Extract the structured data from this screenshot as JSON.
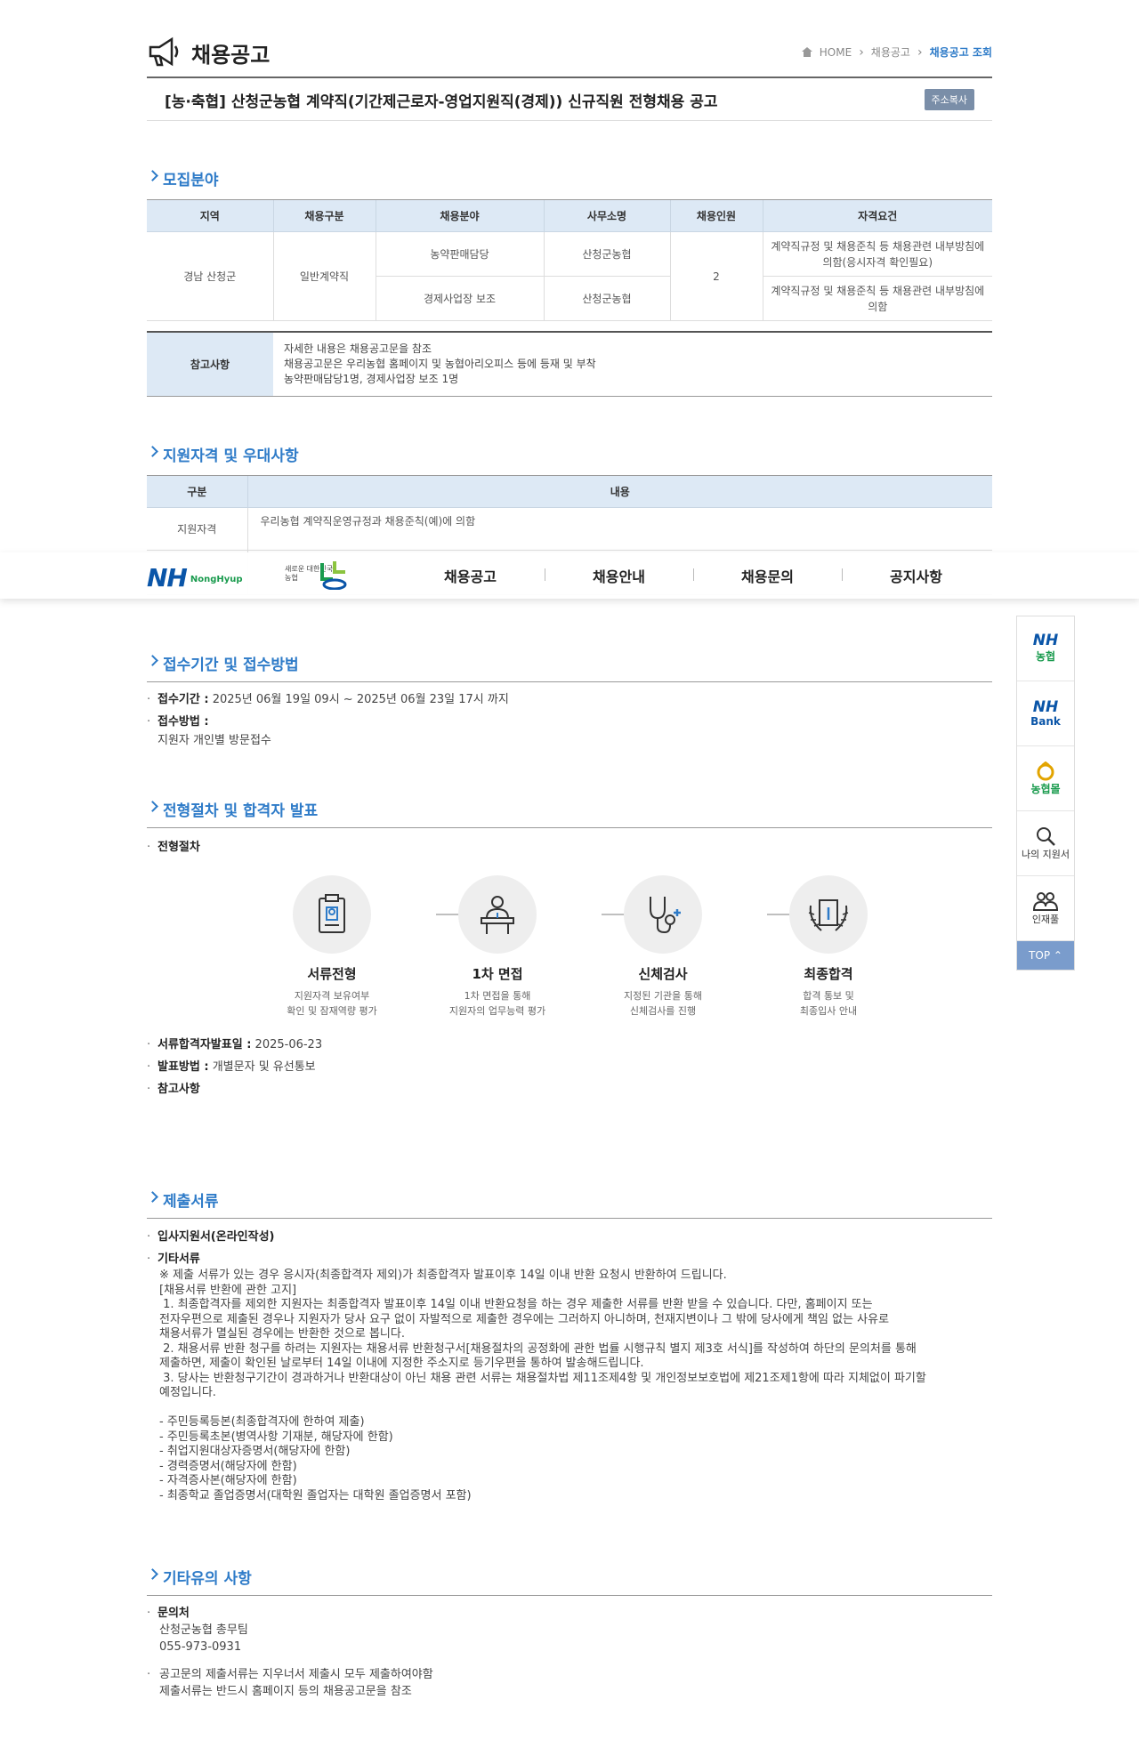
{
  "header": {
    "page_title": "채용공고",
    "breadcrumb": [
      "HOME",
      "채용공고",
      "채용공고 조회"
    ],
    "post_title": "[농·축협] 산청군농협 계약직(기간제근로자-영업지원직(경제)) 신규직원 전형채용 공고",
    "copy_button": "주소복사"
  },
  "recruit": {
    "section_title": "모집분야",
    "columns": [
      "지역",
      "채용구분",
      "채용분야",
      "사무소명",
      "채용인원",
      "자격요건"
    ],
    "region": "경남 산청군",
    "type": "일반계약직",
    "count": "2",
    "rows": [
      {
        "field": "농약판매담당",
        "office": "산청군농협",
        "qual": "계약직규정 및 채용준칙 등 채용관련 내부방침에 의함(응시자격 확인필요)"
      },
      {
        "field": "경제사업장 보조",
        "office": "산청군농협",
        "qual": "계약직규정 및 채용준칙 등 채용관련 내부방침에 의함"
      }
    ],
    "ref_label": "참고사항",
    "ref_lines": [
      "자세한 내용은 채용공고문을 참조",
      "채용공고문은 우리농협 홈페이지 및 농협아리오피스 등에 등재 및 부착",
      "농약판매담당1명, 경제사업장 보조 1명"
    ]
  },
  "qualify": {
    "section_title": "지원자격 및 우대사항",
    "col_category": "구분",
    "col_content": "내용",
    "row_label": "지원자격",
    "row_content": "우리농협 계약직운영규정과 채용준칙(예)에 의함"
  },
  "gnb": {
    "logo_text": "NH",
    "logo_sub": "NongHyup",
    "slogan": "새로운 대한민국 농협",
    "menu": [
      "채용공고",
      "채용안내",
      "채용문의",
      "공지사항"
    ]
  },
  "quick": {
    "items": [
      {
        "big": "NH",
        "small": "농협"
      },
      {
        "big": "NH",
        "small": "Bank"
      },
      {
        "big": "",
        "small": "농협몰"
      },
      {
        "label": "나의 지원서"
      },
      {
        "label": "인재풀"
      }
    ],
    "top": "TOP"
  },
  "receipt": {
    "section_title": "접수기간 및 접수방법",
    "period_label": "접수기간 :",
    "period": "2025년 06월 19일 09시 ~ 2025년 06월 23일 17시 까지",
    "method_label": "접수방법 :",
    "method": "지원자 개인별 방문접수"
  },
  "process": {
    "section_title": "전형절차 및 합격자 발표",
    "label": "전형절차",
    "steps": [
      {
        "name": "서류전형",
        "desc1": "지원자격 보유여부",
        "desc2": "확인 및 잠재역량 평가"
      },
      {
        "name": "1차 면접",
        "desc1": "1차 면접을 통해",
        "desc2": "지원자의 업무능력 평가"
      },
      {
        "name": "신체검사",
        "desc1": "지정된 기관을 통해",
        "desc2": "신체검사를 진행"
      },
      {
        "name": "최종합격",
        "desc1": "합격 통보 및",
        "desc2": "최종입사 안내"
      }
    ],
    "doc_pass_label": "서류합격자발표일 :",
    "doc_pass": "2025-06-23",
    "announce_label": "발표방법 :",
    "announce": "개별문자 및 유선통보",
    "note_label": "참고사항"
  },
  "docs": {
    "section_title": "제출서류",
    "item1": "입사지원서(온라인작성)",
    "item2": "기타서류",
    "body": "※ 제출 서류가 있는 경우 응시자(최종합격자 제외)가 최종합격자 발표이후 14일 이내 반환 요청시 반환하여 드립니다.\n[채용서류 반환에 관한 고지]\n 1. 최종합격자를 제외한 지원자는 최종합격자 발표이후 14일 이내 반환요청을 하는 경우 제출한 서류를 반환 받을 수 있습니다. 다만, 홈페이지 또는\n전자우편으로 제출된 경우나 지원자가 당사 요구 없이 자발적으로 제출한 경우에는 그러하지 아니하며, 천재지변이나 그 밖에 당사에게 책임 없는 사유로\n채용서류가 멸실된 경우에는 반환한 것으로 봅니다.\n 2. 채용서류 반환 청구를 하려는 지원자는 채용서류 반환청구서[채용절차의 공정화에 관한 법률 시행규칙 별지 제3호 서식]를 작성하여 하단의 문의처를 통해\n제출하면, 제출이 확인된 날로부터 14일 이내에 지정한 주소지로 등기우편을 통하여 발송해드립니다.\n 3. 당사는 반환청구기간이 경과하거나 반환대상이 아닌 채용 관련 서류는 채용절차법 제11조제4항 및 개인정보보호법에 제21조제1항에 따라 지체없이 파기할\n예정입니다.\n\n- 주민등록등본(최종합격자에 한하여 제출)\n- 주민등록초본(병역사항 기재분, 해당자에 한함)\n- 취업지원대상자증명서(해당자에 한함)\n- 경력증명서(해당자에 한함)\n- 자격증사본(해당자에 한함)\n- 최종학교 졸업증명서(대학원 졸업자는 대학원 졸업증명서 포함)"
  },
  "etc": {
    "section_title": "기타유의 사항",
    "contact_label": "문의처",
    "contact_name": "산청군농협 총무팀",
    "contact_phone": "055-973-0931",
    "note1": "공고문의 제출서류는 지우너서 제출시 모두 제출하여야함",
    "note2": "제출서류는 반드시 홈페이지 등의 채용공고문을 참조"
  }
}
